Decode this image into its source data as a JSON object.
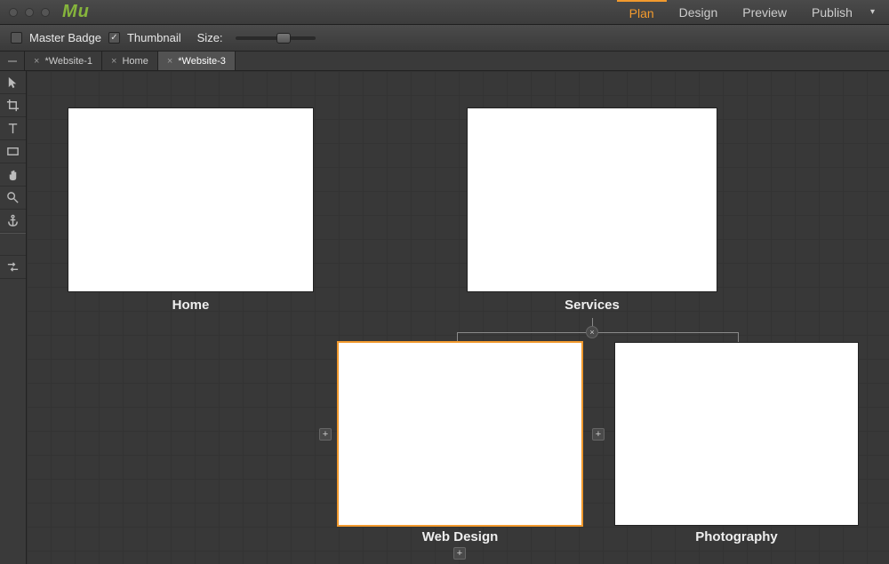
{
  "app": {
    "logo": "Mu"
  },
  "menu": {
    "plan": "Plan",
    "design": "Design",
    "preview": "Preview",
    "publish": "Publish"
  },
  "options": {
    "master_badge": "Master Badge",
    "thumbnail": "Thumbnail",
    "size": "Size:"
  },
  "tabs": {
    "t1": "*Website-1",
    "t2": "Home",
    "t3": "*Website-3"
  },
  "pages": {
    "home": "Home",
    "services": "Services",
    "webdesign": "Web Design",
    "photography": "Photography"
  },
  "glyph": {
    "plus": "+",
    "close": "×"
  }
}
